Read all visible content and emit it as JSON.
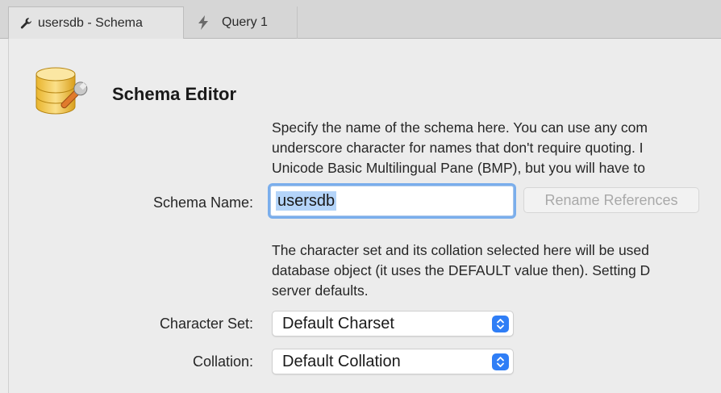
{
  "tabs": [
    {
      "label": "usersdb - Schema",
      "icon": "wrench-icon",
      "active": true
    },
    {
      "label": "Query 1",
      "icon": "lightning-icon",
      "active": false
    }
  ],
  "editor": {
    "title": "Schema Editor",
    "icon": "database-wrench-icon",
    "description_name": [
      "Specify the name of the schema here. You can use any com",
      "underscore character for names that don't require quoting. I",
      "Unicode Basic Multilingual Pane (BMP), but you will have to"
    ],
    "schema_name_label": "Schema Name:",
    "schema_name_value": "usersdb",
    "rename_button_label": "Rename References",
    "description_charset": [
      "The character set and its collation selected here will be used",
      "database object (it uses the DEFAULT value then). Setting D",
      "server defaults."
    ],
    "charset_label": "Character Set:",
    "charset_value": "Default Charset",
    "collation_label": "Collation:",
    "collation_value": "Default Collation"
  },
  "colors": {
    "accent": "#2f7ef6",
    "focus_ring": "#7aaeec",
    "selection": "#b4d4f9"
  }
}
